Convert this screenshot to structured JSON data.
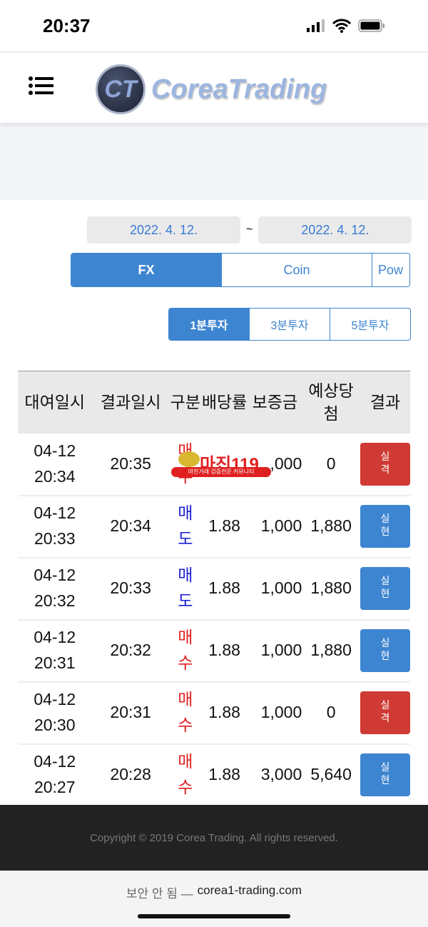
{
  "status": {
    "time": "20:37"
  },
  "header": {
    "logo_text": "CoreaTrading",
    "logo_mark": "CT"
  },
  "filters": {
    "date_from": "2022. 4. 12.",
    "sep": "~",
    "date_to": "2022. 4. 12."
  },
  "tabs": [
    {
      "label": "FX"
    },
    {
      "label": "Coin"
    },
    {
      "label": "Pow"
    }
  ],
  "subtabs": [
    {
      "label": "1분투자"
    },
    {
      "label": "3분투자"
    },
    {
      "label": "5분투자"
    }
  ],
  "table": {
    "headers": [
      "대여일시",
      "결과일시",
      "구분",
      "배당률",
      "보증금",
      "예상당첨",
      "결과"
    ],
    "rows": [
      {
        "date": "04-12",
        "time": "20:34",
        "result_time": "20:35",
        "type": "매수",
        "odds": "",
        "amount": ",000",
        "expected": "0",
        "result": "실격"
      },
      {
        "date": "04-12",
        "time": "20:33",
        "result_time": "20:34",
        "type": "매도",
        "odds": "1.88",
        "amount": "1,000",
        "expected": "1,880",
        "result": "실현"
      },
      {
        "date": "04-12",
        "time": "20:32",
        "result_time": "20:33",
        "type": "매도",
        "odds": "1.88",
        "amount": "1,000",
        "expected": "1,880",
        "result": "실현"
      },
      {
        "date": "04-12",
        "time": "20:31",
        "result_time": "20:32",
        "type": "매수",
        "odds": "1.88",
        "amount": "1,000",
        "expected": "1,880",
        "result": "실현"
      },
      {
        "date": "04-12",
        "time": "20:30",
        "result_time": "20:31",
        "type": "매수",
        "odds": "1.88",
        "amount": "1,000",
        "expected": "0",
        "result": "실격"
      },
      {
        "date": "04-12",
        "time": "20:27",
        "result_time": "20:28",
        "type": "매수",
        "odds": "1.88",
        "amount": "3,000",
        "expected": "5,640",
        "result": "실현"
      }
    ]
  },
  "watermark": {
    "title": "마진119",
    "tagline": "마진거래 검증전문 커뮤니티"
  },
  "footer": {
    "copyright": "Copyright © 2019 Corea Trading. All rights reserved."
  },
  "browser": {
    "warning": "보안 안 됨 —",
    "url": "corea1-trading.com"
  },
  "colors": {
    "accent": "#3d85d0",
    "buy": "#e02020",
    "sell": "#1a20d0",
    "lose": "#cf3a34"
  }
}
